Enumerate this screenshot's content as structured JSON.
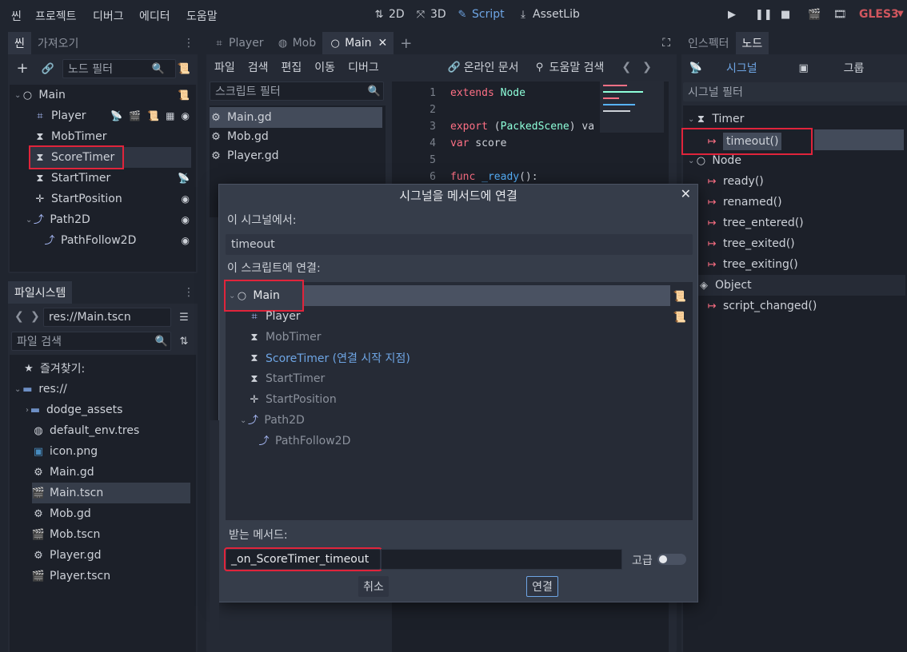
{
  "menubar": {
    "items": [
      "씬",
      "프로젝트",
      "디버그",
      "에디터",
      "도움말"
    ]
  },
  "workspaces": {
    "items": [
      {
        "label": "2D",
        "icon": "2d-icon"
      },
      {
        "label": "3D",
        "icon": "3d-icon"
      },
      {
        "label": "Script",
        "icon": "script-icon"
      },
      {
        "label": "AssetLib",
        "icon": "assetlib-icon"
      }
    ],
    "active": "Script"
  },
  "renderer": "GLES3",
  "scene_dock": {
    "tabs": [
      "씬",
      "가져오기"
    ],
    "filter_placeholder": "노드 필터",
    "nodes": [
      {
        "label": "Main",
        "icon": "node-circle-icon"
      },
      {
        "label": "Player",
        "icon": "area2d-icon"
      },
      {
        "label": "MobTimer",
        "icon": "timer-icon"
      },
      {
        "label": "ScoreTimer",
        "icon": "timer-icon"
      },
      {
        "label": "StartTimer",
        "icon": "timer-icon"
      },
      {
        "label": "StartPosition",
        "icon": "position-icon"
      },
      {
        "label": "Path2D",
        "icon": "path-icon"
      },
      {
        "label": "PathFollow2D",
        "icon": "pathfollow-icon"
      }
    ]
  },
  "filesystem_dock": {
    "title": "파일시스템",
    "path": "res://Main.tscn",
    "search_placeholder": "파일 검색",
    "favorites": "즐겨찾기:",
    "root": "res://",
    "files": [
      "dodge_assets",
      "default_env.tres",
      "icon.png",
      "Main.gd",
      "Main.tscn",
      "Mob.gd",
      "Mob.tscn",
      "Player.gd",
      "Player.tscn"
    ],
    "selected": "Main.tscn"
  },
  "editor_tabs": [
    "Player",
    "Mob",
    "Main"
  ],
  "script_menu": [
    "파일",
    "검색",
    "편집",
    "이동",
    "디버그"
  ],
  "script_toolbar": {
    "online_docs": "온라인 문서",
    "help_search": "도움말 검색"
  },
  "script_list": {
    "filter_placeholder": "스크립트 필터",
    "items": [
      "Main.gd",
      "Mob.gd",
      "Player.gd"
    ]
  },
  "code": {
    "lines": [
      {
        "num": "1",
        "parts": [
          [
            "kw",
            "extends"
          ],
          [
            "tx",
            " "
          ],
          [
            "ty",
            "Node"
          ]
        ]
      },
      {
        "num": "2",
        "parts": []
      },
      {
        "num": "3",
        "parts": [
          [
            "kw",
            "export"
          ],
          [
            "tx",
            " ("
          ],
          [
            "ty",
            "PackedScene"
          ],
          [
            "tx",
            ") va"
          ]
        ]
      },
      {
        "num": "4",
        "parts": [
          [
            "kw",
            "var"
          ],
          [
            "tx",
            " score"
          ]
        ]
      },
      {
        "num": "5",
        "parts": []
      },
      {
        "num": "6",
        "parts": [
          [
            "kw",
            "func"
          ],
          [
            "tx",
            " "
          ],
          [
            "fn",
            "_ready"
          ],
          [
            "tx",
            "():"
          ]
        ]
      }
    ]
  },
  "inspector": {
    "tabs": [
      "인스펙터",
      "노드"
    ],
    "subtabs": {
      "signals": "시그널",
      "groups": "그룹"
    },
    "filter_placeholder": "시그널 필터",
    "sections": [
      {
        "name": "Timer",
        "icon": "timer-icon",
        "signals": [
          "timeout()"
        ]
      },
      {
        "name": "Node",
        "icon": "node-circle-icon",
        "signals": [
          "ready()",
          "renamed()",
          "tree_entered()",
          "tree_exited()",
          "tree_exiting()"
        ]
      },
      {
        "name": "Object",
        "icon": "object-icon",
        "signals": [
          "script_changed()"
        ]
      }
    ]
  },
  "dialog": {
    "title": "시그널을 메서드에 연결",
    "from_signal_label": "이 시그널에서:",
    "signal_value": "timeout",
    "connect_to_label": "이 스크립트에 연결:",
    "nodes": [
      {
        "label": "Main"
      },
      {
        "label": "Player"
      },
      {
        "label": "MobTimer"
      },
      {
        "label": "ScoreTimer (연결 시작 지점)"
      },
      {
        "label": "StartTimer"
      },
      {
        "label": "StartPosition"
      },
      {
        "label": "Path2D"
      },
      {
        "label": "PathFollow2D"
      }
    ],
    "receiver_label": "받는 메서드:",
    "method_value": "_on_ScoreTimer_timeout",
    "advanced_label": "고급",
    "cancel": "취소",
    "connect": "연결"
  },
  "colors": {
    "accent": "#6ea5e4",
    "highlight": "#e0243b",
    "renderer": "#d1565e"
  }
}
